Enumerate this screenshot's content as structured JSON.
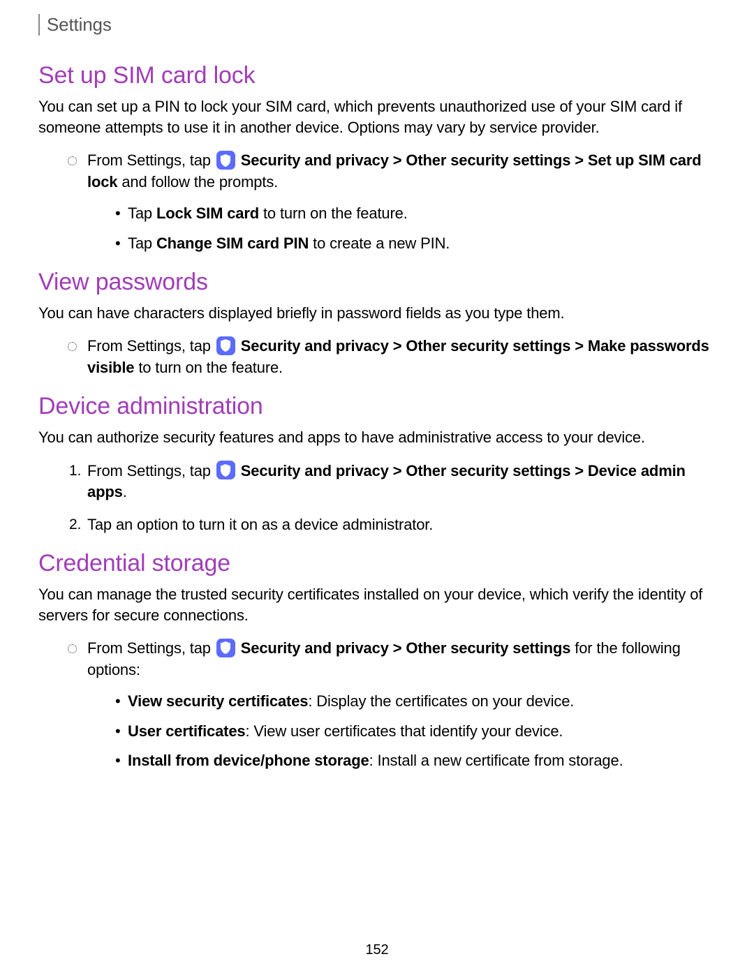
{
  "header": {
    "title": "Settings"
  },
  "icon_label": "Security and privacy",
  "sections": [
    {
      "heading": "Set up SIM card lock",
      "intro": "You can set up a PIN to lock your SIM card, which prevents unauthorized use of your SIM card if someone attempts to use it in another device. Options may vary by service provider.",
      "list_type": "circle",
      "items": [
        {
          "pre": "From Settings, tap ",
          "path_bold": "Security and privacy > Other security settings > Set up SIM card lock",
          "post": " and follow the prompts.",
          "subitems": [
            {
              "pre": "Tap ",
              "bold": "Lock SIM card",
              "post": " to turn on the feature."
            },
            {
              "pre": "Tap ",
              "bold": "Change SIM card PIN",
              "post": " to create a new PIN."
            }
          ]
        }
      ]
    },
    {
      "heading": "View passwords",
      "intro": "You can have characters displayed briefly in password fields as you type them.",
      "list_type": "circle",
      "items": [
        {
          "pre": "From Settings, tap ",
          "path_bold": "Security and privacy > Other security settings > Make passwords visible",
          "post": " to turn on the feature."
        }
      ]
    },
    {
      "heading": "Device administration",
      "intro": "You can authorize security features and apps to have administrative access to your device.",
      "list_type": "numbered",
      "items": [
        {
          "pre": "From Settings, tap ",
          "path_bold": "Security and privacy > Other security settings > Device admin apps",
          "post": "."
        },
        {
          "pre": "Tap an option to turn it on as a device administrator.",
          "no_icon": true
        }
      ]
    },
    {
      "heading": "Credential storage",
      "intro": "You can manage the trusted security certificates installed on your device, which verify the identity of servers for secure connections.",
      "list_type": "circle",
      "items": [
        {
          "pre": "From Settings, tap ",
          "path_bold": "Security and privacy > Other security settings",
          "post": " for the following options:",
          "subitems": [
            {
              "bold": "View security certificates",
              "post": ": Display the certificates on your device."
            },
            {
              "bold": "User certificates",
              "post": ": View user certificates that identify your device."
            },
            {
              "bold": "Install from device/phone storage",
              "post": ": Install a new certificate from storage."
            }
          ]
        }
      ]
    }
  ],
  "page_number": "152"
}
